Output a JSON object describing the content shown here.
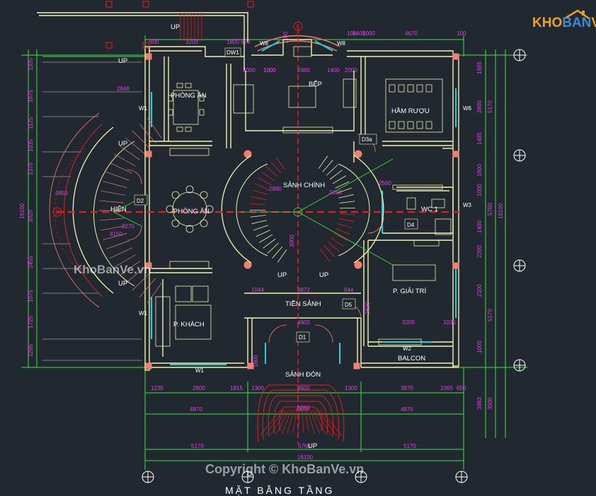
{
  "logo": {
    "text_part1": "KHO",
    "text_part2": "BAN",
    "text_part3": "VE",
    "color_orange": "#f0a020",
    "color_blue": "#3b8ad8"
  },
  "watermarks": {
    "middle": "KhoBanVe.vn",
    "bottom": "Copyright © KhoBanVe.vn"
  },
  "title": "MẶT BẰNG TẦNG",
  "rooms": {
    "bep": "BẾP",
    "phong_an_top": "PHÒNG ĂN",
    "ham_ruou": "HẦM RƯỢU",
    "sanh_chinh": "SẢNH CHÍNH",
    "hien": "HIÊN",
    "phong_an": "PHÒNG ĂN",
    "wc1": "WC 1",
    "p_giai_tri": "P. GIẢI TRÍ",
    "tien_sanh": "TIỀN SẢNH",
    "p_khach": "P. KHÁCH",
    "balcon": "BALCON",
    "sanh_don": "SẢNH ĐÓN"
  },
  "stairs": {
    "up_top": "UP",
    "up_left_top": "UP",
    "up_hien1": "UP",
    "up_hien2": "UP",
    "up_center_l": "UP",
    "up_center_r": "UP",
    "up_bottom": "UP"
  },
  "doors": {
    "dw1": "DW1",
    "w8a": "W8",
    "w8b": "W8",
    "w1a": "W1",
    "w1b": "W1",
    "w1c": "W1",
    "w6": "W6",
    "w3": "W3",
    "w2": "W2",
    "d2": "D2",
    "d3a": "D3a",
    "d4": "D4",
    "d5": "D5",
    "d1": "D1"
  },
  "grid": {
    "a": "A",
    "b": "B"
  },
  "dims_top": [
    "600",
    "3200",
    "1800",
    "670",
    "1100",
    "100",
    "1400",
    "1000",
    "4670",
    "100"
  ],
  "dims_inner_top": [
    "2000",
    "1000",
    "2460",
    "1400",
    "2000"
  ],
  "dims_bottom_row1": [
    "1235",
    "2800",
    "1815",
    "1300",
    "1300",
    "3870",
    "1065",
    "600"
  ],
  "dims_bottom_row2": [
    "4870",
    "4870",
    "4870"
  ],
  "dims_bottom_row3": [
    "5170",
    "5760",
    "5170"
  ],
  "dims_bottom_row4": [
    "16100"
  ],
  "dims_left_col": [
    "1335",
    "1675",
    "1125",
    "1035",
    "1370",
    "3020",
    "2455",
    "1075",
    "1725",
    "1295",
    "16100"
  ],
  "dims_right_col": [
    "1685",
    "2600",
    "1485",
    "1600",
    "1000",
    "1400",
    "2200",
    "2100",
    "1000",
    "3983",
    "5170",
    "5760",
    "5170",
    "16100",
    "3500"
  ],
  "dims_misc": [
    "2648",
    "4850",
    "2270",
    "8150",
    "2880",
    "3160",
    "3872",
    "1044",
    "944",
    "4600",
    "3200",
    "1035",
    "1000",
    "2620",
    "1800",
    "3600",
    "5050",
    "2560",
    "3000"
  ],
  "colors": {
    "bg": "#212830",
    "wall": "#f2f2b0",
    "dim": "#44e044",
    "magenta": "#e040e0",
    "red": "#e02020",
    "cyan": "#20d0e0",
    "yellow": "#f0e000",
    "salmon": "#f08070"
  }
}
